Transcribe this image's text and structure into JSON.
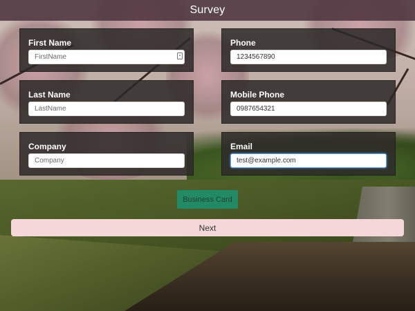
{
  "app": {
    "title": "Survey"
  },
  "form": {
    "first_name": {
      "label": "First Name",
      "placeholder": "FirstName",
      "value": ""
    },
    "last_name": {
      "label": "Last Name",
      "placeholder": "LastName",
      "value": ""
    },
    "company": {
      "label": "Company",
      "placeholder": "Company",
      "value": ""
    },
    "phone": {
      "label": "Phone",
      "placeholder": "",
      "value": "1234567890"
    },
    "mobile_phone": {
      "label": "Mobile Phone",
      "placeholder": "",
      "value": "0987654321"
    },
    "email": {
      "label": "Email",
      "placeholder": "",
      "value": "test@example.com"
    }
  },
  "actions": {
    "business_card_label": "Business Card",
    "next_label": "Next"
  },
  "icons": {
    "autofill": "autofill-contact-icon"
  },
  "colors": {
    "header_bg": "#4d343f",
    "card_bg": "#2d2a29",
    "business_card_button": "#1f8e6b",
    "next_button": "#f5d7d9",
    "focus_ring": "#5fa8e6"
  }
}
